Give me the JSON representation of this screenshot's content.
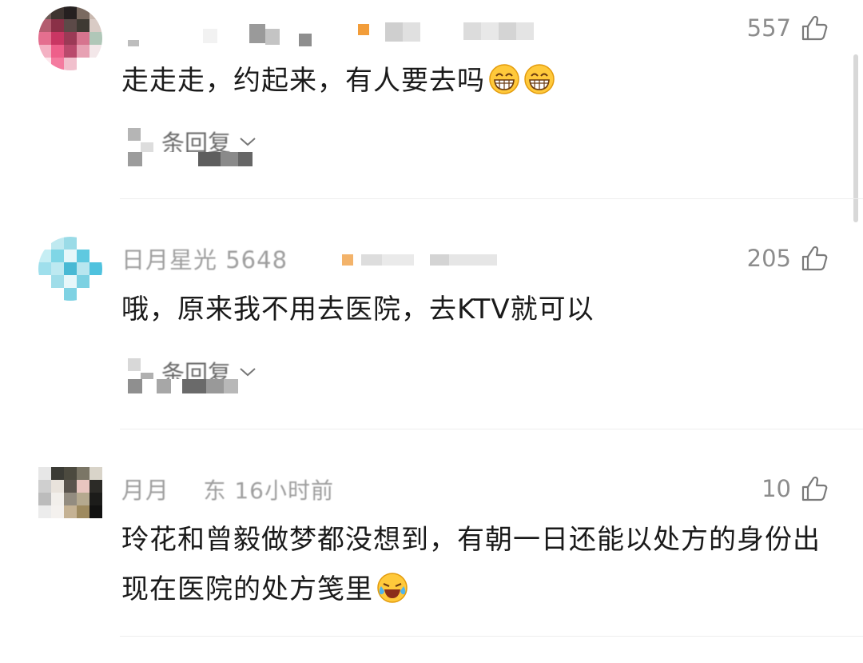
{
  "comments": [
    {
      "username": "",
      "likes": "557",
      "text": "走走走，约起来，有人要去吗",
      "emoji": [
        "grin-emoji",
        "grin-emoji"
      ],
      "replies_label": "条回复"
    },
    {
      "username": "日月星光 5648",
      "likes": "205",
      "text": "哦，原来我不用去医院，去KTV就可以",
      "emoji": [],
      "replies_label": "条回复"
    },
    {
      "username": "月月",
      "location_time": "东 16小时前",
      "likes": "10",
      "text": "玲花和曾毅做梦都没想到，有朝一日还能以处方的身份出现在医院的处方笺里",
      "emoji": [
        "laugh-cry-emoji"
      ]
    }
  ],
  "colors": {
    "text": "#1a1a1a",
    "meta": "#9e9e9e",
    "divider": "#eeeeee"
  }
}
